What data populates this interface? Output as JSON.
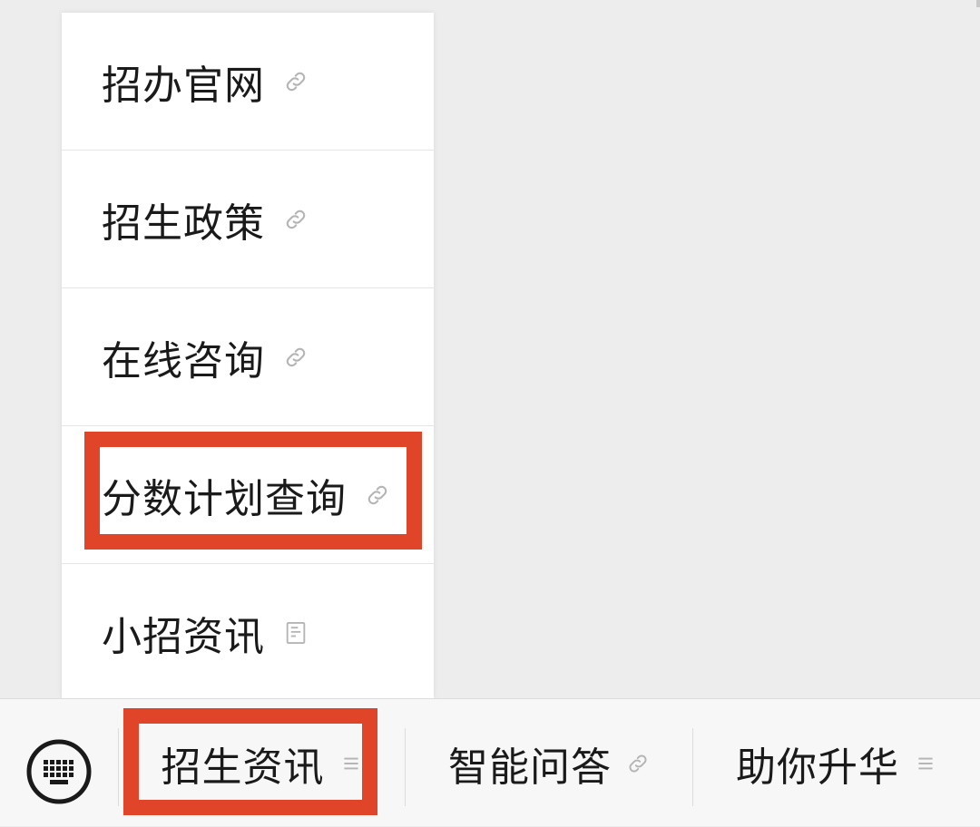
{
  "submenu": {
    "items": [
      {
        "label": "招办官网",
        "icon": "link-icon"
      },
      {
        "label": "招生政策",
        "icon": "link-icon"
      },
      {
        "label": "在线咨询",
        "icon": "link-icon"
      },
      {
        "label": "分数计划查询",
        "icon": "link-icon"
      },
      {
        "label": "小招资讯",
        "icon": "article-icon"
      }
    ]
  },
  "bottom_bar": {
    "keyboard_icon": "keyboard-icon",
    "menus": [
      {
        "label": "招生资讯",
        "icon": "menu-lines-icon"
      },
      {
        "label": "智能问答",
        "icon": "link-icon"
      },
      {
        "label": "助你升华",
        "icon": "menu-lines-icon"
      }
    ]
  },
  "colors": {
    "highlight": "#e0452a",
    "page_background": "#ededed",
    "menu_background": "#ffffff",
    "text": "#1a1a1a",
    "icon_gray": "#b5b5b5"
  }
}
